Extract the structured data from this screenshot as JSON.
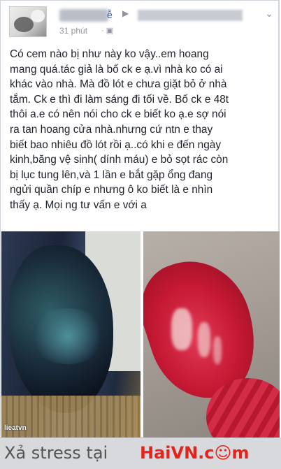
{
  "post": {
    "author_suffix": "ễ",
    "time": "31 phút",
    "privacy_icon": "globe-icon",
    "menu_icon": "chevron-down-icon",
    "text": "Có cem nào bị như này ko vậy..em hoang\nmang quá.tác giả là bố ck e ạ.vì nhà ko có ai\nkhác vào nhà. Mà đồ lót e chưa giặt bỏ ở nhà\ntắm. Ck e thì đi làm sáng đi tối về. Bố ck e 48t\nthôi a.e có nên nói cho ck e biết ko ạ.e sợ nói\nra tan hoang cửa nhà.nhưng cứ ntn e thay\nbiết bao nhiêu đồ lót rồi ạ..có khi e đến ngày\nkinh,băng vệ sinh( dính máu) e bỏ sọt rác còn\nbị lục tung lên,và 1 lần e bắt gặp ổng đang\nngửi quần chíp e nhưng ô ko biết là e nhìn\nthấy ạ. Mọi ng tư vấn e với a",
    "photo_left_watermark": "lieatvn"
  },
  "footer": {
    "text": "Xả stress tại",
    "brand": "HaiVN.c☺m"
  }
}
